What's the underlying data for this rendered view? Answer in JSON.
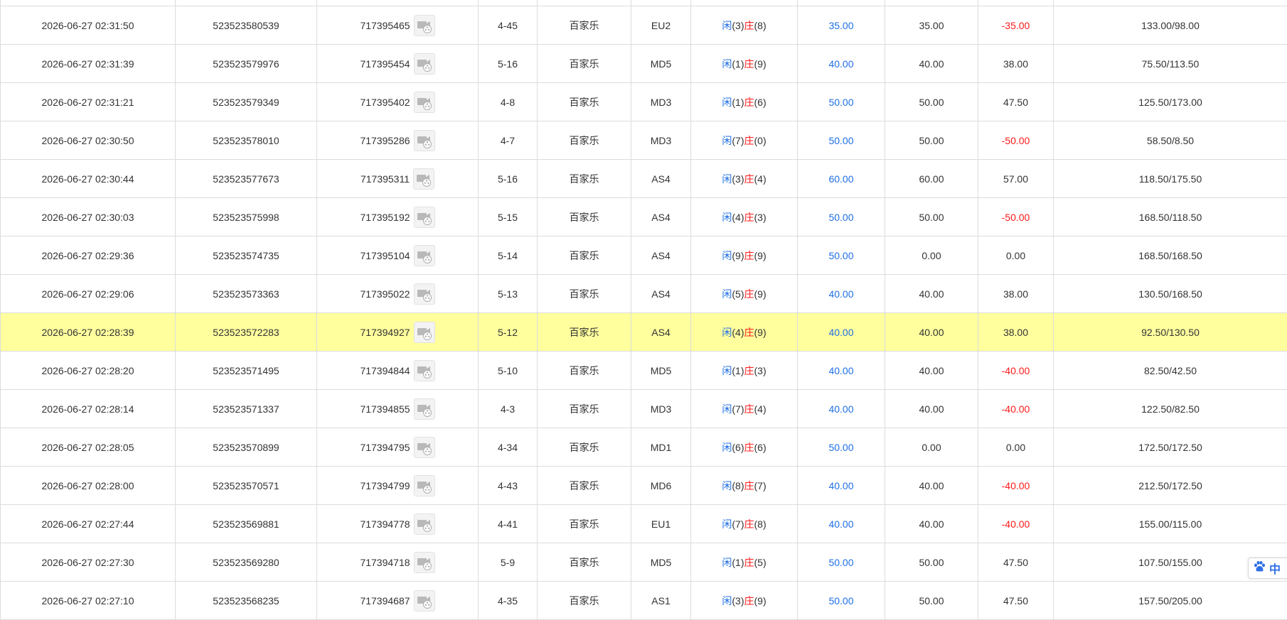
{
  "colors": {
    "player_blue": "#1f6fe5",
    "banker_red": "#ff1a1a",
    "highlight_row": "#ffff9e",
    "grid_border": "#dcdcdc",
    "text": "#333333"
  },
  "icons": {
    "replay": "video-replay-icon",
    "ime": "baidu-paw-icon"
  },
  "rows": [
    {
      "time": "",
      "bet_no": "",
      "round_no": "",
      "shoe": "",
      "game": "",
      "table": "",
      "player_label": "",
      "player_pts": "",
      "banker_label": "",
      "banker_pts": "",
      "bet": "",
      "valid": "",
      "win": "",
      "win_class": "dark",
      "balance": ""
    },
    {
      "time": "2026-06-27 02:31:50",
      "bet_no": "523523580539",
      "round_no": "717395465",
      "shoe": "4-45",
      "game": "百家乐",
      "table": "EU2",
      "player_label": "闲",
      "player_pts": "(3)",
      "banker_label": "庄",
      "banker_pts": "(8)",
      "bet": "35.00",
      "valid": "35.00",
      "win": "-35.00",
      "win_class": "red",
      "balance": "133.00/98.00"
    },
    {
      "time": "2026-06-27 02:31:39",
      "bet_no": "523523579976",
      "round_no": "717395454",
      "shoe": "5-16",
      "game": "百家乐",
      "table": "MD5",
      "player_label": "闲",
      "player_pts": "(1)",
      "banker_label": "庄",
      "banker_pts": "(9)",
      "bet": "40.00",
      "valid": "40.00",
      "win": "38.00",
      "win_class": "dark",
      "balance": "75.50/113.50"
    },
    {
      "time": "2026-06-27 02:31:21",
      "bet_no": "523523579349",
      "round_no": "717395402",
      "shoe": "4-8",
      "game": "百家乐",
      "table": "MD3",
      "player_label": "闲",
      "player_pts": "(1)",
      "banker_label": "庄",
      "banker_pts": "(6)",
      "bet": "50.00",
      "valid": "50.00",
      "win": "47.50",
      "win_class": "dark",
      "balance": "125.50/173.00"
    },
    {
      "time": "2026-06-27 02:30:50",
      "bet_no": "523523578010",
      "round_no": "717395286",
      "shoe": "4-7",
      "game": "百家乐",
      "table": "MD3",
      "player_label": "闲",
      "player_pts": "(7)",
      "banker_label": "庄",
      "banker_pts": "(0)",
      "bet": "50.00",
      "valid": "50.00",
      "win": "-50.00",
      "win_class": "red",
      "balance": "58.50/8.50"
    },
    {
      "time": "2026-06-27 02:30:44",
      "bet_no": "523523577673",
      "round_no": "717395311",
      "shoe": "5-16",
      "game": "百家乐",
      "table": "AS4",
      "player_label": "闲",
      "player_pts": "(3)",
      "banker_label": "庄",
      "banker_pts": "(4)",
      "bet": "60.00",
      "valid": "60.00",
      "win": "57.00",
      "win_class": "dark",
      "balance": "118.50/175.50"
    },
    {
      "time": "2026-06-27 02:30:03",
      "bet_no": "523523575998",
      "round_no": "717395192",
      "shoe": "5-15",
      "game": "百家乐",
      "table": "AS4",
      "player_label": "闲",
      "player_pts": "(4)",
      "banker_label": "庄",
      "banker_pts": "(3)",
      "bet": "50.00",
      "valid": "50.00",
      "win": "-50.00",
      "win_class": "red",
      "balance": "168.50/118.50"
    },
    {
      "time": "2026-06-27 02:29:36",
      "bet_no": "523523574735",
      "round_no": "717395104",
      "shoe": "5-14",
      "game": "百家乐",
      "table": "AS4",
      "player_label": "闲",
      "player_pts": "(9)",
      "banker_label": "庄",
      "banker_pts": "(9)",
      "bet": "50.00",
      "valid": "0.00",
      "win": "0.00",
      "win_class": "dark",
      "balance": "168.50/168.50"
    },
    {
      "time": "2026-06-27 02:29:06",
      "bet_no": "523523573363",
      "round_no": "717395022",
      "shoe": "5-13",
      "game": "百家乐",
      "table": "AS4",
      "player_label": "闲",
      "player_pts": "(5)",
      "banker_label": "庄",
      "banker_pts": "(9)",
      "bet": "40.00",
      "valid": "40.00",
      "win": "38.00",
      "win_class": "dark",
      "balance": "130.50/168.50"
    },
    {
      "time": "2026-06-27 02:28:39",
      "bet_no": "523523572283",
      "round_no": "717394927",
      "shoe": "5-12",
      "game": "百家乐",
      "table": "AS4",
      "player_label": "闲",
      "player_pts": "(4)",
      "banker_label": "庄",
      "banker_pts": "(9)",
      "bet": "40.00",
      "valid": "40.00",
      "win": "38.00",
      "win_class": "dark",
      "balance": "92.50/130.50",
      "highlight": true
    },
    {
      "time": "2026-06-27 02:28:20",
      "bet_no": "523523571495",
      "round_no": "717394844",
      "shoe": "5-10",
      "game": "百家乐",
      "table": "MD5",
      "player_label": "闲",
      "player_pts": "(1)",
      "banker_label": "庄",
      "banker_pts": "(3)",
      "bet": "40.00",
      "valid": "40.00",
      "win": "-40.00",
      "win_class": "red",
      "balance": "82.50/42.50"
    },
    {
      "time": "2026-06-27 02:28:14",
      "bet_no": "523523571337",
      "round_no": "717394855",
      "shoe": "4-3",
      "game": "百家乐",
      "table": "MD3",
      "player_label": "闲",
      "player_pts": "(7)",
      "banker_label": "庄",
      "banker_pts": "(4)",
      "bet": "40.00",
      "valid": "40.00",
      "win": "-40.00",
      "win_class": "red",
      "balance": "122.50/82.50"
    },
    {
      "time": "2026-06-27 02:28:05",
      "bet_no": "523523570899",
      "round_no": "717394795",
      "shoe": "4-34",
      "game": "百家乐",
      "table": "MD1",
      "player_label": "闲",
      "player_pts": "(6)",
      "banker_label": "庄",
      "banker_pts": "(6)",
      "bet": "50.00",
      "valid": "0.00",
      "win": "0.00",
      "win_class": "dark",
      "balance": "172.50/172.50"
    },
    {
      "time": "2026-06-27 02:28:00",
      "bet_no": "523523570571",
      "round_no": "717394799",
      "shoe": "4-43",
      "game": "百家乐",
      "table": "MD6",
      "player_label": "闲",
      "player_pts": "(8)",
      "banker_label": "庄",
      "banker_pts": "(7)",
      "bet": "40.00",
      "valid": "40.00",
      "win": "-40.00",
      "win_class": "red",
      "balance": "212.50/172.50"
    },
    {
      "time": "2026-06-27 02:27:44",
      "bet_no": "523523569881",
      "round_no": "717394778",
      "shoe": "4-41",
      "game": "百家乐",
      "table": "EU1",
      "player_label": "闲",
      "player_pts": "(7)",
      "banker_label": "庄",
      "banker_pts": "(8)",
      "bet": "40.00",
      "valid": "40.00",
      "win": "-40.00",
      "win_class": "red",
      "balance": "155.00/115.00"
    },
    {
      "time": "2026-06-27 02:27:30",
      "bet_no": "523523569280",
      "round_no": "717394718",
      "shoe": "5-9",
      "game": "百家乐",
      "table": "MD5",
      "player_label": "闲",
      "player_pts": "(1)",
      "banker_label": "庄",
      "banker_pts": "(5)",
      "bet": "50.00",
      "valid": "50.00",
      "win": "47.50",
      "win_class": "dark",
      "balance": "107.50/155.00"
    },
    {
      "time": "2026-06-27 02:27:10",
      "bet_no": "523523568235",
      "round_no": "717394687",
      "shoe": "4-35",
      "game": "百家乐",
      "table": "AS1",
      "player_label": "闲",
      "player_pts": "(3)",
      "banker_label": "庄",
      "banker_pts": "(9)",
      "bet": "50.00",
      "valid": "50.00",
      "win": "47.50",
      "win_class": "dark",
      "balance": "157.50/205.00"
    }
  ],
  "ime": {
    "mode_label": "中"
  }
}
